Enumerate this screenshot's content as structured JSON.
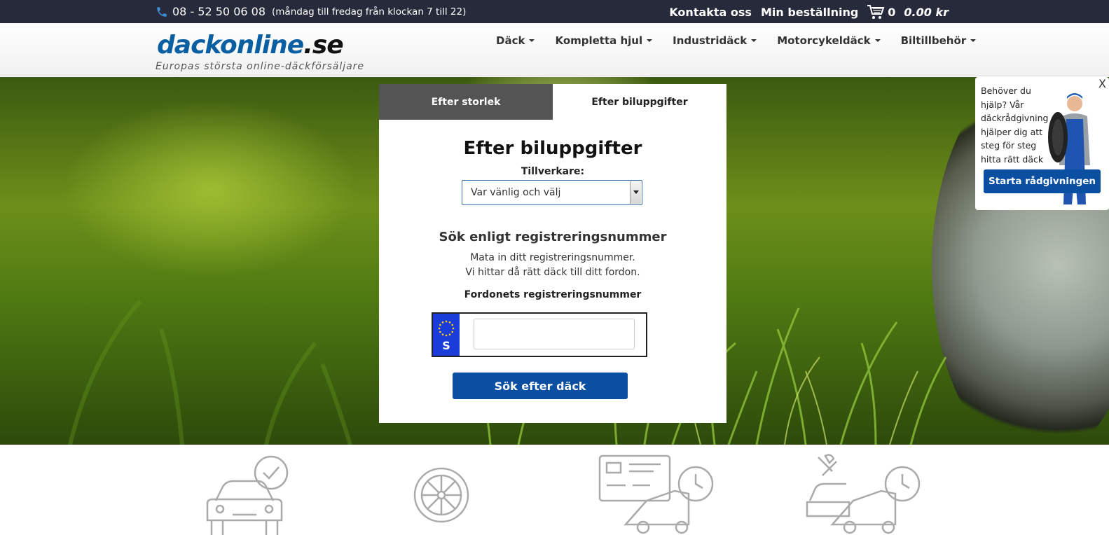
{
  "topbar": {
    "phone": "08 - 52 50 06 08",
    "hours": "(måndag till fredag från klockan 7 till 22)",
    "contact": "Kontakta oss",
    "order": "Min beställning",
    "cart_count": "0",
    "cart_total": "0.00 kr"
  },
  "header": {
    "logo_part1": "dackonline",
    "logo_part2": ".se",
    "tagline": "Europas största online-däckförsäljare",
    "nav": [
      "Däck",
      "Kompletta hjul",
      "Industridäck",
      "Motorcykeldäck",
      "Biltillbehör"
    ]
  },
  "search": {
    "tab_size": "Efter storlek",
    "tab_car": "Efter biluppgifter",
    "title": "Efter biluppgifter",
    "manufacturer_label": "Tillverkare:",
    "manufacturer_value": "Var vänlig och välj",
    "reg_title": "Sök enligt registreringsnummer",
    "reg_desc1": "Mata in ditt registreringsnummer.",
    "reg_desc2": "Vi hittar då rätt däck till ditt fordon.",
    "reg_label": "Fordonets registreringsnummer",
    "plate_country": "S",
    "plate_value": "",
    "button": "Sök efter däck"
  },
  "help": {
    "close": "X",
    "text": "Behöver du hjälp? Vår däckrådgivning hjälper dig att steg för steg hitta rätt däck",
    "button": "Starta rådgivningen"
  },
  "colors": {
    "topbar": "#262a3a",
    "brand_blue": "#0a4fa2",
    "logo_blue": "#0a5fa2"
  }
}
